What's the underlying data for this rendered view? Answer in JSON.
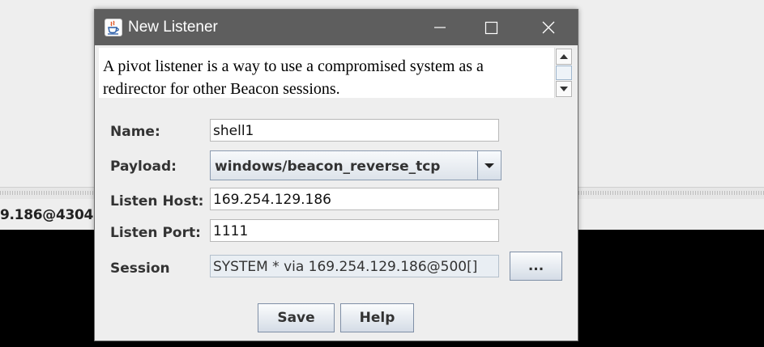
{
  "background": {
    "tab_label": "9.186@4304[]"
  },
  "dialog": {
    "title": "New Listener",
    "description": "A pivot listener is a way to use a compromised system as a redirector for other Beacon sessions.",
    "name_label": "Name:",
    "name_value": "shell1",
    "payload_label": "Payload:",
    "payload_value": "windows/beacon_reverse_tcp",
    "host_label": "Listen Host:",
    "host_value": "169.254.129.186",
    "port_label": "Listen Port:",
    "port_value": "1111",
    "session_label": "Session",
    "session_value": "SYSTEM * via  169.254.129.186@500[]",
    "browse_label": "...",
    "save_label": "Save",
    "help_label": "Help"
  },
  "icons": {
    "app": "java-cup-icon",
    "minimize": "minimize-icon",
    "maximize": "maximize-icon",
    "close": "close-icon",
    "dropdown": "chevron-down-icon",
    "scroll_up": "scroll-up-arrow-icon",
    "scroll_down": "scroll-down-arrow-icon"
  },
  "colors": {
    "titlebar": "#5e5e5e",
    "dialog_bg": "#eeeeee",
    "console_bg": "#000000"
  }
}
